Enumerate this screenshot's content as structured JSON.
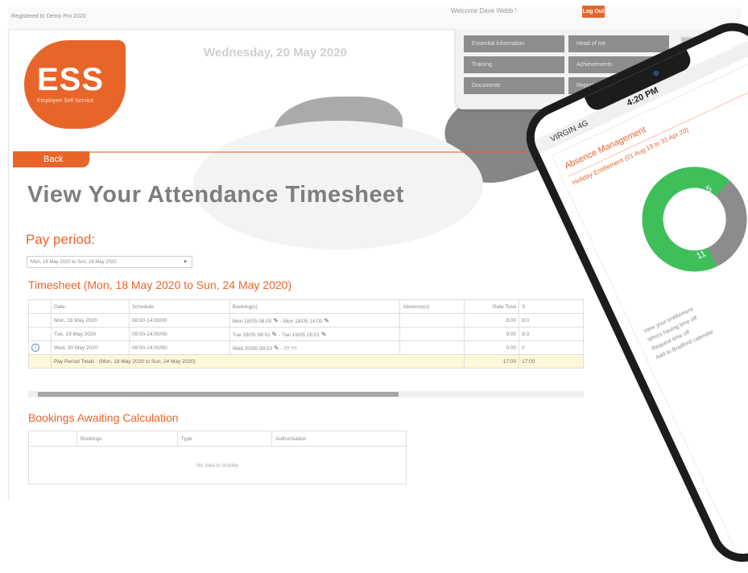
{
  "topbar": {
    "registered": "Registered to Demo Pro 2020",
    "welcome": "Welcome Dave Webb !",
    "logout": "Log Out"
  },
  "menu": {
    "items": [
      "Essential information",
      "Training",
      "Documents",
      "Head of me",
      "Achievements",
      "Report Accident"
    ]
  },
  "logo": {
    "text": "ESS",
    "subtitle": "Employee Self Service"
  },
  "date": "Wednesday, 20 May 2020",
  "back_label": "Back",
  "page_title": "View Your Attendance Timesheet",
  "pay_period": {
    "label": "Pay period:",
    "selected": "Mon, 18 May 2020 to Sun, 24 May 2020"
  },
  "timesheet": {
    "title": "Timesheet (Mon, 18 May 2020 to Sun, 24 May 2020)",
    "columns": [
      "Date",
      "Schedule",
      "Booking(s)",
      "Absence(s)",
      "Rate Total",
      "S"
    ],
    "rows": [
      {
        "date": "Mon, 18 May 2020",
        "schedule": "08:00-14:00/00",
        "booking_in": "Mon 18/05 08:00",
        "booking_out": "- Mon 18/05 14:00",
        "absence": "",
        "rate_total": "8:00",
        "s": "8:0"
      },
      {
        "date": "Tue, 19 May 2020",
        "schedule": "08:00-14:00/00",
        "booking_in": "Tue 19/05 08:01",
        "booking_out": "- Tue 19/05 16:01",
        "absence": "",
        "rate_total": "9:00",
        "s": "9:0"
      },
      {
        "date": "Wed, 20 May 2020",
        "schedule": "08:00-14:00/50",
        "booking_in": "Wed 20/05 09:53",
        "booking_out": "- ??:??",
        "absence": "",
        "rate_total": "0:00",
        "s": "0"
      }
    ],
    "totals": {
      "label": "Pay Period Totals : (Mon, 18 May 2020 to Sun, 24 May 2020)",
      "rate_total": "17:00",
      "s": "17:00"
    }
  },
  "bookings_awaiting": {
    "title": "Bookings Awaiting Calculation",
    "columns": [
      "Bookings",
      "Type",
      "Authorisation"
    ],
    "empty": "No data to display"
  },
  "phone": {
    "carrier": "VIRGIN 4G",
    "time": "4:20 PM",
    "section_title": "Absence Management",
    "entitlement": "Holiday Entitlement (01 Aug 19 to 31 Apr 20)",
    "donut_large_value": "11",
    "donut_small_value": "5",
    "donut_large_fraction": 0.6875,
    "bullets": [
      "View your entitlement",
      "Who's having time off",
      "Request time off",
      "Add to Bradford calendar"
    ]
  },
  "colors": {
    "accent": "#e8652a",
    "donut_green": "#3fbf5a",
    "donut_gray": "#8c8c8c"
  }
}
